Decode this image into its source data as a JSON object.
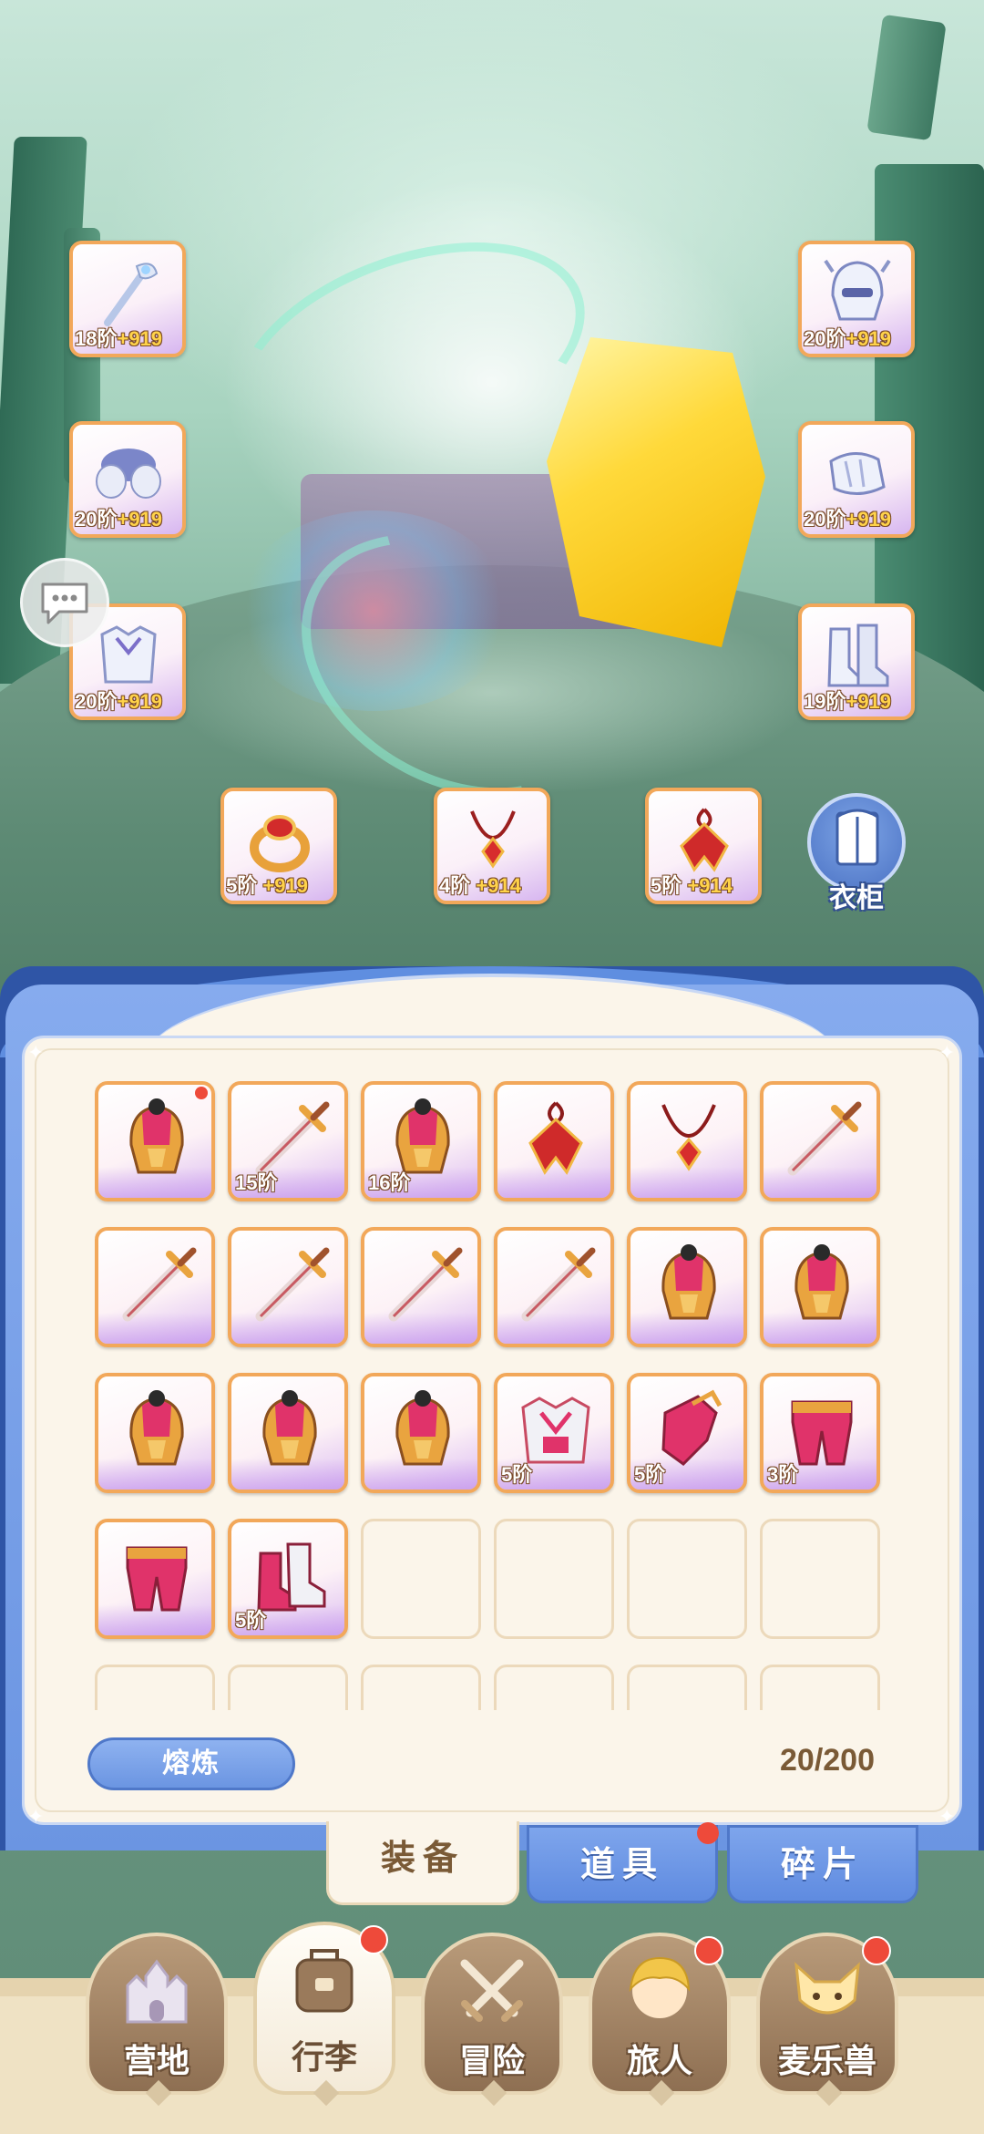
{
  "equipment_slots": [
    {
      "tier": "18阶",
      "bonus": "+919",
      "icon": "staff-icon"
    },
    {
      "tier": "20阶",
      "bonus": "+919",
      "icon": "helmet-icon"
    },
    {
      "tier": "20阶",
      "bonus": "+919",
      "icon": "pauldron-icon"
    },
    {
      "tier": "20阶",
      "bonus": "+919",
      "icon": "gauntlet-icon"
    },
    {
      "tier": "20阶",
      "bonus": "+919",
      "icon": "chest-armor-icon"
    },
    {
      "tier": "19阶",
      "bonus": "+919",
      "icon": "boots-icon"
    },
    {
      "tier": "5阶",
      "bonus": "+919",
      "icon": "ring-icon"
    },
    {
      "tier": "4阶",
      "bonus": "+914",
      "icon": "necklace-icon"
    },
    {
      "tier": "5阶",
      "bonus": "+914",
      "icon": "amulet-icon"
    }
  ],
  "wardrobe_label": "衣柜",
  "bag_items": [
    {
      "icon": "helmet-icon",
      "tier": "",
      "new": true
    },
    {
      "icon": "sword-icon",
      "tier": "15阶"
    },
    {
      "icon": "helmet-icon",
      "tier": "16阶"
    },
    {
      "icon": "amulet-icon",
      "tier": ""
    },
    {
      "icon": "necklace-icon",
      "tier": ""
    },
    {
      "icon": "sword-icon",
      "tier": ""
    },
    {
      "icon": "sword-icon",
      "tier": ""
    },
    {
      "icon": "sword-icon",
      "tier": ""
    },
    {
      "icon": "sword-icon",
      "tier": ""
    },
    {
      "icon": "sword-icon",
      "tier": ""
    },
    {
      "icon": "helmet-icon",
      "tier": ""
    },
    {
      "icon": "helmet-icon",
      "tier": ""
    },
    {
      "icon": "helmet-icon",
      "tier": ""
    },
    {
      "icon": "helmet-icon",
      "tier": ""
    },
    {
      "icon": "helmet-icon",
      "tier": ""
    },
    {
      "icon": "chest-armor-icon",
      "tier": "5阶"
    },
    {
      "icon": "gauntlet-icon",
      "tier": "5阶"
    },
    {
      "icon": "pants-icon",
      "tier": "3阶"
    },
    {
      "icon": "pants-icon",
      "tier": ""
    },
    {
      "icon": "boots-icon",
      "tier": "5阶"
    }
  ],
  "bag_empty_slots": 10,
  "smelt_label": "熔炼",
  "capacity": "20/200",
  "tabs": [
    {
      "label": "装备",
      "active": true,
      "badge": false
    },
    {
      "label": "道具",
      "active": false,
      "badge": true
    },
    {
      "label": "碎片",
      "active": false,
      "badge": false
    }
  ],
  "nav": [
    {
      "label": "营地",
      "icon": "castle-icon",
      "active": false,
      "badge": false
    },
    {
      "label": "行李",
      "icon": "backpack-icon",
      "active": true,
      "badge": true
    },
    {
      "label": "冒险",
      "icon": "crossed-swords-icon",
      "active": false,
      "badge": false
    },
    {
      "label": "旅人",
      "icon": "character-icon",
      "active": false,
      "badge": true
    },
    {
      "label": "麦乐兽",
      "icon": "pet-icon",
      "active": false,
      "badge": true
    }
  ],
  "colors": {
    "slot_border": "#f2a85a",
    "panel_blue": "#6b95e2",
    "panel_cream": "#fbf5ea",
    "badge_red": "#ee4a3a",
    "text_brown": "#7a5a36"
  }
}
